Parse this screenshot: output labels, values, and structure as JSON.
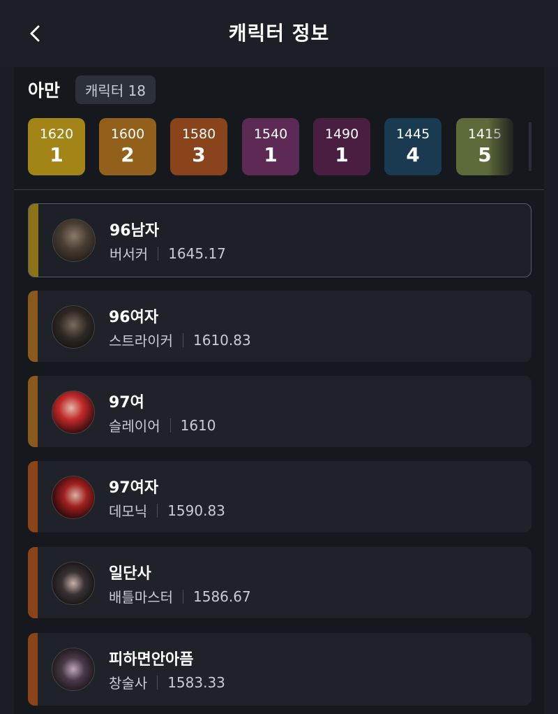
{
  "header": {
    "title": "캐릭터 정보"
  },
  "server": {
    "name": "아만",
    "count_label": "캐릭터 18"
  },
  "levels": [
    {
      "ilvl": "1620",
      "count": "1",
      "color": "#a38517"
    },
    {
      "ilvl": "1600",
      "count": "2",
      "color": "#93601b"
    },
    {
      "ilvl": "1580",
      "count": "3",
      "color": "#89441c"
    },
    {
      "ilvl": "1540",
      "count": "1",
      "color": "#5c2a55"
    },
    {
      "ilvl": "1490",
      "count": "1",
      "color": "#4a1e40"
    },
    {
      "ilvl": "1445",
      "count": "4",
      "color": "#1a3a52"
    },
    {
      "ilvl": "1415",
      "count": "5",
      "color": "#5d6b3a"
    }
  ],
  "characters": [
    {
      "name": "96남자",
      "class": "버서커",
      "ilvl": "1645.17",
      "stripe": "#8a7417"
    },
    {
      "name": "96여자",
      "class": "스트라이커",
      "ilvl": "1610.83",
      "stripe": "#8a5a1c"
    },
    {
      "name": "97여",
      "class": "슬레이어",
      "ilvl": "1610",
      "stripe": "#8a5a1c"
    },
    {
      "name": "97여자",
      "class": "데모닉",
      "ilvl": "1590.83",
      "stripe": "#8a4418"
    },
    {
      "name": "일단사",
      "class": "배틀마스터",
      "ilvl": "1586.67",
      "stripe": "#8a4418"
    },
    {
      "name": "피하면안아픔",
      "class": "창술사",
      "ilvl": "1583.33",
      "stripe": "#8a4418"
    }
  ]
}
